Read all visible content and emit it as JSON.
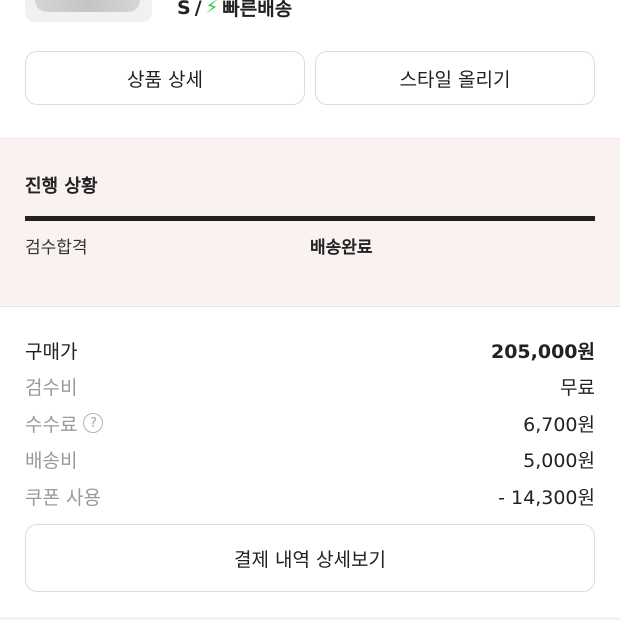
{
  "product": {
    "size": "S",
    "separator": "/",
    "bolt_icon": "lightning-icon",
    "shipping": "빠른배송"
  },
  "actions": {
    "detail_label": "상품 상세",
    "style_label": "스타일 올리기"
  },
  "progress": {
    "title": "진행 상황",
    "fraction": 1.0,
    "steps": [
      "검수합격",
      "배송완료"
    ]
  },
  "price": {
    "rows": [
      {
        "label": "구매가",
        "value": "205,000원"
      },
      {
        "label": "검수비",
        "value": "무료"
      },
      {
        "label": "수수료",
        "value": "6,700원",
        "help": "?"
      },
      {
        "label": "배송비",
        "value": "5,000원"
      },
      {
        "label": "쿠폰 사용",
        "value": "- 14,300원"
      }
    ]
  },
  "payment": {
    "button_label": "결제 내역 상세보기"
  },
  "colors": {
    "accent_green": "#2ac64d",
    "panel_bg": "#faf1f1",
    "progress_bar": "#222222"
  }
}
